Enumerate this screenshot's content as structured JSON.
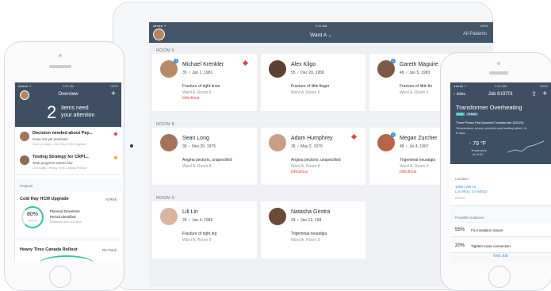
{
  "ipad": {
    "status": {
      "carrier": "●●●●● ᯤ",
      "time": "9:41 AM",
      "battery": "100%"
    },
    "nav": {
      "title": "Ward A",
      "chevron": "⌄",
      "right": "All Patients"
    },
    "rooms": [
      {
        "label": "ROOM 6"
      },
      {
        "label": "ROOM 8"
      },
      {
        "label": "ROOM 9"
      }
    ],
    "patients": [
      {
        "name": "Michael Krenkler",
        "meta": "35 ♂ Jan 1, 1981",
        "diagnosis": "Fracture of right knee",
        "location": "Ward A, Room 6",
        "flag": "Infectious",
        "badge": "3",
        "photo_color": "#b98a6a"
      },
      {
        "name": "Alex Kilgo",
        "meta": "55 ♂ Dec 20, 1958",
        "diagnosis": "Fracture of little finger",
        "location": "Ward A, Room 6",
        "flag": "",
        "badge": "",
        "photo_color": "#5b4131"
      },
      {
        "name": "Gareth Maguire",
        "meta": "48 ♂ Jan 5, 1983",
        "diagnosis": "Fracture of little fin",
        "location": "Ward A, Room 6",
        "flag": "",
        "badge": "2",
        "photo_color": "#7d5a45"
      },
      {
        "name": "Sean Long",
        "meta": "36 ♂ Nov 20, 1979",
        "diagnosis": "Angina pectoris, unspecified",
        "location": "Ward A, Room 8",
        "flag": "",
        "badge": "",
        "photo_color": "#a57458"
      },
      {
        "name": "Adam Humphrey",
        "meta": "36 ♂ May 2, 1979",
        "diagnosis": "Angina pectoris, unspecified",
        "location": "Ward A, Room 8",
        "flag": "Infectious",
        "badge": "",
        "photo_color": "#c79f86"
      },
      {
        "name": "Megan Zurcher",
        "meta": "48 ♀ Jul 4, 1967",
        "diagnosis": "Trigeminal neuralgia",
        "location": "Ward A, Room 9",
        "flag": "Infectious",
        "badge": "2",
        "photo_color": "#b7654a"
      },
      {
        "name": "Lili Lin",
        "meta": "28 ♀ Jun 4, 1989",
        "diagnosis": "Fracture of right leg",
        "location": "Ward A, Room 9",
        "flag": "",
        "badge": "",
        "photo_color": "#d8b59c"
      },
      {
        "name": "Natasha Girotra",
        "meta": "34 ♀ Jan 12, 198",
        "diagnosis": "Trigeminal neuralgia",
        "location": "Ward A, Room 9",
        "flag": "",
        "badge": "",
        "photo_color": "#6b4a38"
      }
    ]
  },
  "left_phone": {
    "status": {
      "carrier": "●●●●● ᯤ",
      "time": "9:41 AM",
      "battery": "100%"
    },
    "title": "Overview",
    "plus": "+",
    "count": "2",
    "count_text_1": "Items need",
    "count_text_2": "your attention",
    "tasks": [
      {
        "title": "Decision needed about Pay...",
        "subtitle": "Issue not yet resolved",
        "detail": "Due in 2 days • Cold Ray HCM Upgrade",
        "dot_color": "#e0473d"
      },
      {
        "title": "Testing Strategy for CRPI...",
        "subtitle": "Task progress seems low",
        "detail": "Due today • Heavy Tires Canada Rollout",
        "dot_color": "#f0a830"
      }
    ],
    "projects_label": "Projects",
    "project1": {
      "title": "Cold Ray HCM Upgrade",
      "status": "At Risk",
      "percent": "80%",
      "percent_label": "Progress",
      "note1": "Planned Downtime",
      "note2": "Period Identified",
      "note3": "Milestone due in 8 days"
    },
    "project2": {
      "title": "Heavy Tires Canada Rollout",
      "status": "On Track"
    }
  },
  "right_phone": {
    "status": {
      "carrier": "●●●●● ᯤ",
      "time": "9:41 AM",
      "battery": "100%"
    },
    "back": "‹ Jobs",
    "title": "Job 819701",
    "headline": "Transformer Overheating",
    "tag1": "P2M",
    "tag2": "Critical",
    "desc1": "Three Phase Pad Mounted Transformer (53423)",
    "desc2": "Temperature sensor predicts overheating failure in",
    "desc3": "8 days",
    "temp": "- 79 °F",
    "temp_label": "Temperature",
    "temp_sub": "at 10:00",
    "location_label": "Location",
    "address1": "1009 Lyell St,",
    "address2": "Los Altos, CA 94022",
    "address3": "Arrived",
    "solutions_label": "Possible Solutions",
    "solutions": [
      {
        "percent": "55%",
        "text": "Fix insulation issues"
      },
      {
        "percent": "20%",
        "text": "Tighten loose connection"
      }
    ],
    "end_job": "End Job"
  },
  "colors": {
    "nav": "#44556a",
    "accent": "#3b8ed9",
    "alert": "#e0473d"
  }
}
